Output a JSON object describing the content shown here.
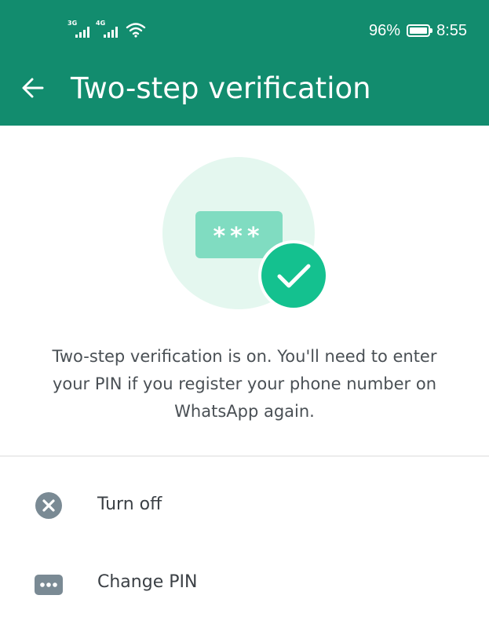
{
  "status_bar": {
    "network_1": "3G",
    "network_2": "4G",
    "battery_text": "96%",
    "battery_level": 0.96,
    "time": "8:55"
  },
  "app_bar": {
    "title": "Two-step verification",
    "back_icon": "arrow-back-icon"
  },
  "illustration": {
    "pin_mask": "***",
    "check_icon": "check-icon"
  },
  "description": "Two-step verification is on. You'll need to enter your PIN if you register your phone number on WhatsApp again.",
  "options": [
    {
      "label": "Turn off",
      "icon": "close-circle-icon"
    },
    {
      "label": "Change PIN",
      "icon": "pin-dots-icon"
    }
  ],
  "colors": {
    "header": "#128c6e",
    "accent": "#14c18f",
    "illus_bg": "#e4f7ef",
    "pin_card": "#80dcc1"
  }
}
